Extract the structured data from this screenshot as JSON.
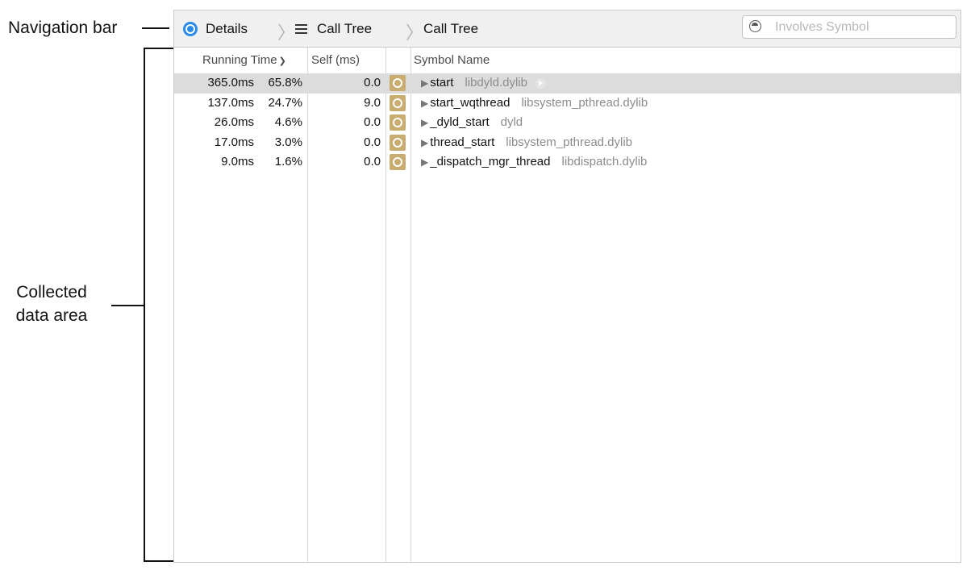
{
  "callouts": {
    "navigation_bar": "Navigation bar",
    "collected_data_line1": "Collected",
    "collected_data_line2": "data area"
  },
  "navbar": {
    "breadcrumbs": [
      {
        "label": "Details",
        "icon": "details-icon"
      },
      {
        "label": "Call Tree",
        "icon": "list-icon"
      },
      {
        "label": "Call Tree"
      }
    ],
    "search": {
      "placeholder": "Involves Symbol",
      "value": ""
    }
  },
  "table": {
    "headers": {
      "running_time": "Running Time",
      "self": "Self (ms)",
      "symbol": "Symbol Name"
    },
    "rows": [
      {
        "running_ms": "365.0ms",
        "percent": "65.8%",
        "self_ms": "0.0",
        "symbol": "start",
        "library": "libdyld.dylib",
        "selected": true
      },
      {
        "running_ms": "137.0ms",
        "percent": "24.7%",
        "self_ms": "9.0",
        "symbol": "start_wqthread",
        "library": "libsystem_pthread.dylib",
        "selected": false
      },
      {
        "running_ms": "26.0ms",
        "percent": "4.6%",
        "self_ms": "0.0",
        "symbol": "_dyld_start",
        "library": "dyld",
        "selected": false
      },
      {
        "running_ms": "17.0ms",
        "percent": "3.0%",
        "self_ms": "0.0",
        "symbol": "thread_start",
        "library": "libsystem_pthread.dylib",
        "selected": false
      },
      {
        "running_ms": "9.0ms",
        "percent": "1.6%",
        "self_ms": "0.0",
        "symbol": "_dispatch_mgr_thread",
        "library": "libdispatch.dylib",
        "selected": false
      }
    ]
  },
  "colors": {
    "details_icon": "#2a8ce8",
    "gear_badge": "#c9ac6f",
    "selected_row": "#dcdcdc"
  }
}
